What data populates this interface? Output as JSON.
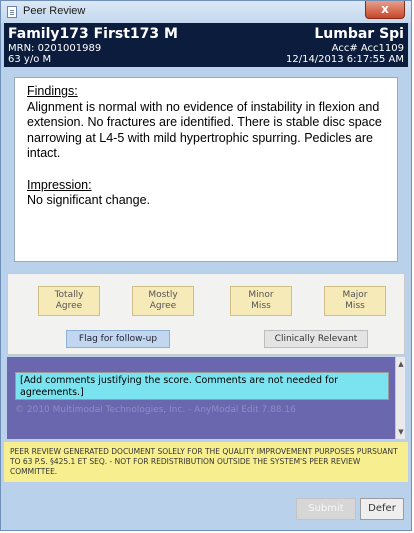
{
  "window": {
    "title": "Peer Review",
    "close_glyph": "x",
    "icon": "document-icon"
  },
  "header": {
    "patient_name": "Family173 First173 M",
    "exam_title": "Lumbar Spi",
    "mrn": "MRN: 0201001989",
    "accession": "Acc# Acc1109",
    "age": "63 y/o M",
    "datetime": "12/14/2013 6:17:55 AM"
  },
  "report": {
    "findings_heading": "Findings:",
    "findings_text": "Alignment is normal with no evidence of instability in flexion and extension.  No fractures are identified.  There is stable disc space narrowing at L4-5 with mild hypertrophic spurring.  Pedicles are intact.",
    "impression_heading": "Impression:",
    "impression_text": "No significant change."
  },
  "scores": [
    {
      "line1": "Totally",
      "line2": "Agree"
    },
    {
      "line1": "Mostly",
      "line2": "Agree"
    },
    {
      "line1": "Minor",
      "line2": "Miss"
    },
    {
      "line1": "Major",
      "line2": "Miss"
    }
  ],
  "flags": {
    "follow_up": "Flag for follow-up",
    "clinically_relevant": "Clinically Relevant"
  },
  "comments": {
    "placeholder": "[Add comments justifying the score.  Comments are not needed for agreements.]",
    "copyright": "© 2010 Multimodal Technologies, Inc. - AnyModal Edit 7.88.16"
  },
  "disclaimer": "PEER REVIEW GENERATED DOCUMENT SOLELY FOR THE QUALITY IMPROVEMENT PURPOSES PURSUANT TO 63 P.S. §425.1 ET SEQ. - NOT FOR REDISTRIBUTION OUTSIDE THE SYSTEM'S PEER REVIEW COMMITTEE.",
  "footer": {
    "submit_label": "Submit",
    "defer_label": "Defer"
  },
  "colors": {
    "header_bg": "#0c1c3d",
    "score_button": "#f6eab9",
    "comments_bg": "#6a67ae",
    "comment_field": "#7be3ef",
    "disclaimer_bg": "#f7ef8f"
  }
}
